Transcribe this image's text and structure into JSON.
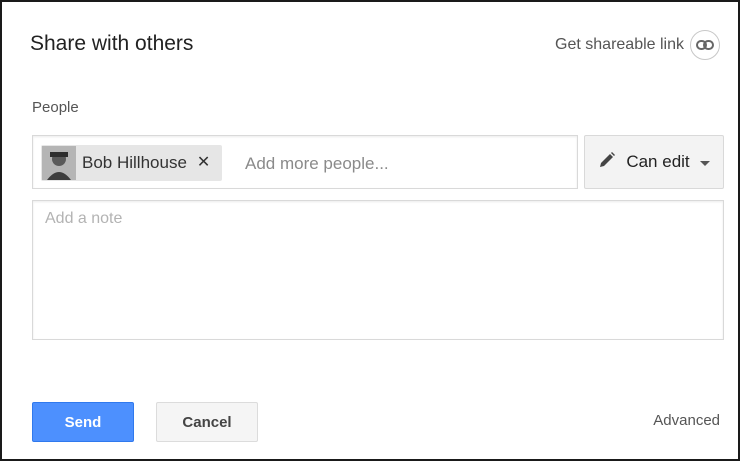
{
  "dialog": {
    "title": "Share with others",
    "share_link_label": "Get shareable link"
  },
  "people": {
    "label": "People",
    "chips": [
      {
        "name": "Bob Hillhouse",
        "remove_icon": "close-icon"
      }
    ],
    "add_placeholder": "Add more people...",
    "permission": {
      "label": "Can edit",
      "icon": "pencil-icon"
    }
  },
  "note": {
    "placeholder": "Add a note"
  },
  "actions": {
    "send_label": "Send",
    "cancel_label": "Cancel",
    "advanced_label": "Advanced"
  },
  "colors": {
    "primary": "#4d90fe",
    "primary_border": "#3079ed",
    "chip_bg": "#e6e6e6",
    "border": "#d9d9d9",
    "text": "#222222",
    "muted": "#555555"
  }
}
